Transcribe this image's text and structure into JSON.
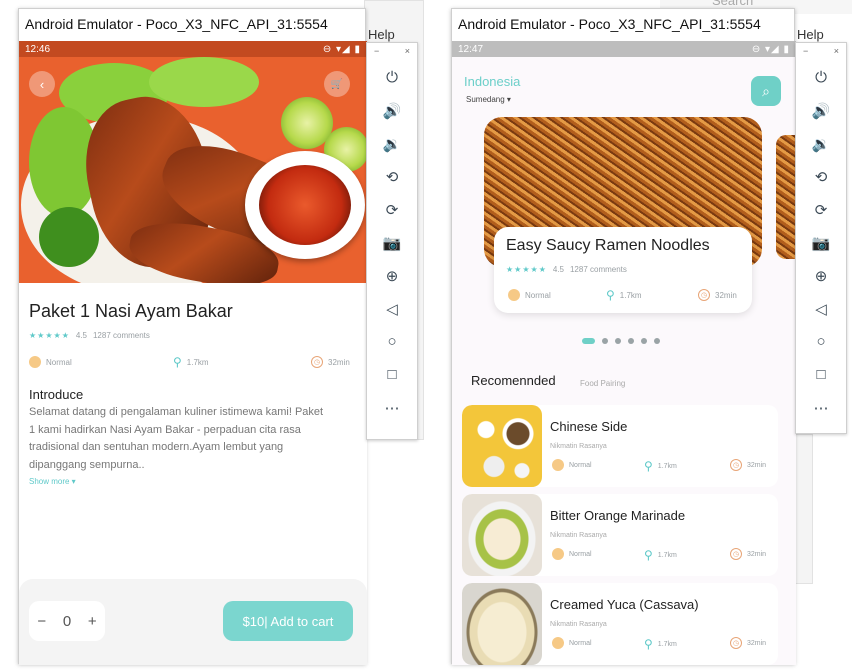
{
  "background": {
    "help_left": "Help",
    "help_right": "Help",
    "search_fragment": "Search"
  },
  "left_window": {
    "title": "Android Emulator - Poco_X3_NFC_API_31:5554",
    "status_time": "12:46",
    "status_right": "⊖ ▾◢ ▮",
    "back_icon": "chevron-left-icon",
    "cart_icon": "cart-icon",
    "food_title": "Paket 1 Nasi Ayam Bakar",
    "stars": "★★★★★",
    "rating": "4.5",
    "comments": "1287 comments",
    "level": "Normal",
    "distance": "1.7km",
    "duration": "32min",
    "intro_heading": "Introduce",
    "intro_lines": [
      "Selamat datang di pengalaman kuliner istimewa kami! Paket",
      "1 kami hadirkan Nasi Ayam Bakar - perpaduan cita rasa",
      "tradisional dan sentuhan modern.Ayam lembut yang",
      "dipanggang sempurna.."
    ],
    "show_more": "Show more ▾",
    "stepper_minus": "−",
    "stepper_value": "0",
    "stepper_plus": "+",
    "add_to_cart": "$10| Add to cart",
    "accent": "#7bd6cf"
  },
  "right_window": {
    "title": "Android Emulator - Poco_X3_NFC_API_31:5554",
    "status_time": "12:47",
    "status_right": "⊖ ▾◢ ▮",
    "country": "Indonesia",
    "city": "Sumedang ▾",
    "search_icon": "search-icon",
    "featured": {
      "title": "Easy Saucy Ramen Noodles",
      "stars": "★★★★★",
      "rating": "4.5",
      "comments": "1287 comments",
      "level": "Normal",
      "distance": "1.7km",
      "duration": "32min"
    },
    "carousel_count": 6,
    "recommended_heading": "Recomennded",
    "recommended_sub": "Food Pairing",
    "recommended": [
      {
        "title": "Chinese Side",
        "author": "Nikmatin Rasanya",
        "level": "Normal",
        "distance": "1.7km",
        "duration": "32min"
      },
      {
        "title": "Bitter Orange Marinade",
        "author": "Nikmatin Rasanya",
        "level": "Normal",
        "distance": "1.7km",
        "duration": "32min"
      },
      {
        "title": "Creamed Yuca (Cassava)",
        "author": "Nikmatin Rasanya",
        "level": "Normal",
        "distance": "1.7km",
        "duration": "32min"
      }
    ]
  },
  "emulator_side": {
    "minimize": "−",
    "close": "×",
    "icons": [
      "power-icon",
      "volume-up-icon",
      "volume-down-icon",
      "rotate-left-icon",
      "rotate-right-icon",
      "camera-icon",
      "zoom-icon",
      "back-icon",
      "home-icon",
      "overview-icon",
      "more-icon"
    ],
    "glyphs": [
      "⏻",
      "🔊",
      "🔉",
      "⟲",
      "⟳",
      "📷",
      "⊕",
      "◁",
      "○",
      "□",
      "⋯"
    ]
  }
}
